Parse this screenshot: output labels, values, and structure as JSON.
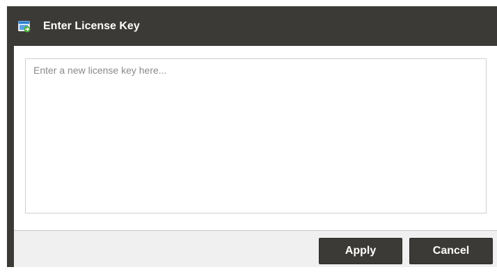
{
  "dialog": {
    "title": "Enter License Key",
    "icon": "license-window-icon"
  },
  "license_input": {
    "value": "",
    "placeholder": "Enter a new license key here..."
  },
  "footer": {
    "apply_label": "Apply",
    "cancel_label": "Cancel"
  },
  "colors": {
    "titlebar": "#3b3a36",
    "button": "#3b3a36",
    "footer": "#f0f0f0",
    "icon_blue": "#2f7fd1",
    "icon_green": "#4caf3a"
  }
}
